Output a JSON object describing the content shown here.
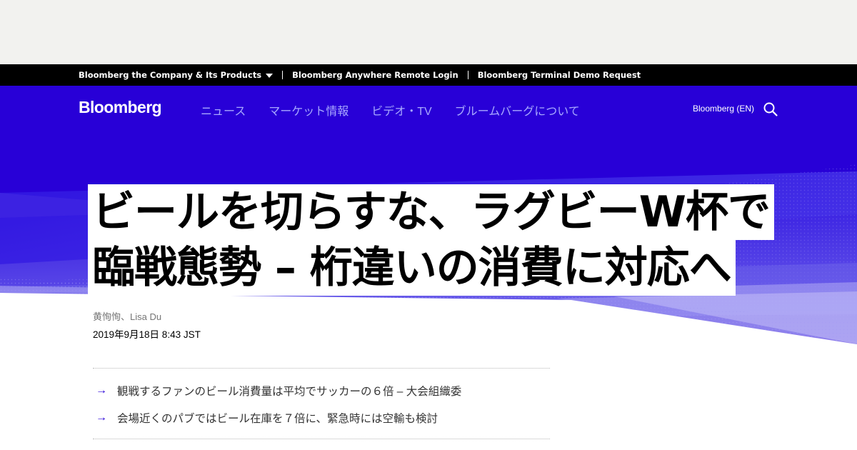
{
  "company_bar": {
    "items": [
      "Bloomberg the Company & Its Products",
      "Bloomberg Anywhere Remote Login",
      "Bloomberg Terminal Demo Request"
    ]
  },
  "nav": {
    "logo": "Bloomberg",
    "links": [
      "ニュース",
      "マーケット情報",
      "ビデオ・TV",
      "ブルームバーグについて"
    ],
    "lang": "Bloomberg (EN)"
  },
  "article": {
    "headline_lines": [
      "ビールを切らすな、ラグビーW杯で",
      "臨戦態勢 – 桁違いの消費に対応へ"
    ],
    "authors": "黄恂恂、Lisa Du",
    "timestamp": "2019年9月18日 8:43 JST",
    "summary": [
      "観戦するファンのビール消費量は平均でサッカーの６倍 – 大会組織委",
      "会場近くのパブではビール在庫を７倍に、緊急時には空輸も検討"
    ]
  },
  "colors": {
    "brand_blue": "#2800d7",
    "company_bar": "#000000",
    "ad_area": "#f2f2ef",
    "nav_link": "#a8a8ff"
  },
  "icons": [
    "caret-down-icon",
    "search-icon",
    "arrow-right-icon"
  ]
}
